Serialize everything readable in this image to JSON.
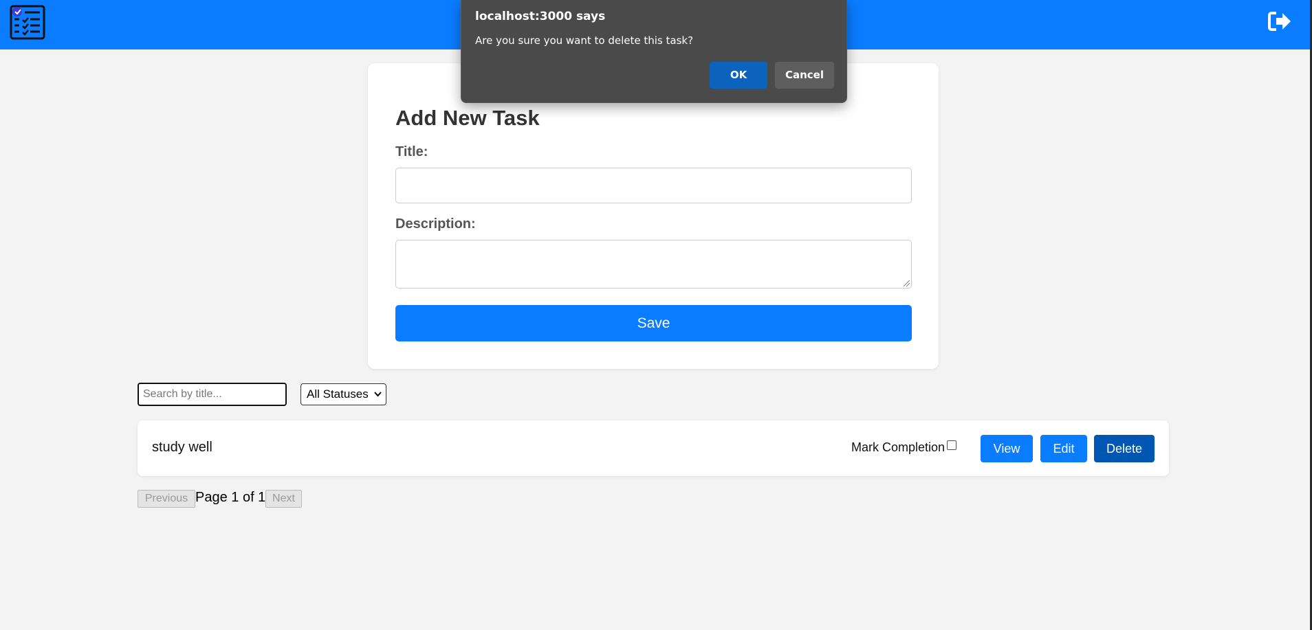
{
  "header": {
    "logo_icon": "task-checklist-icon",
    "logout_icon": "logout-icon",
    "background": "#0a7cff"
  },
  "form": {
    "heading": "Add New Task",
    "title_label": "Title:",
    "title_value": "",
    "description_label": "Description:",
    "description_value": "",
    "save_label": "Save"
  },
  "filters": {
    "search_placeholder": "Search by title...",
    "status_selected": "All Statuses"
  },
  "tasks": [
    {
      "title": "study well",
      "mark_label": "Mark Completion",
      "completed": false,
      "view_label": "View",
      "edit_label": "Edit",
      "delete_label": "Delete"
    }
  ],
  "pagination": {
    "prev_label": "Previous",
    "info": "Page 1 of 1",
    "next_label": "Next"
  },
  "dialog": {
    "title": "localhost:3000 says",
    "message": "Are you sure you want to delete this task?",
    "ok_label": "OK",
    "cancel_label": "Cancel"
  },
  "colors": {
    "primary": "#0a7cff",
    "delete_active": "#0056b3",
    "dialog_bg": "#4a4a4a",
    "dialog_ok": "#0b63bd"
  }
}
